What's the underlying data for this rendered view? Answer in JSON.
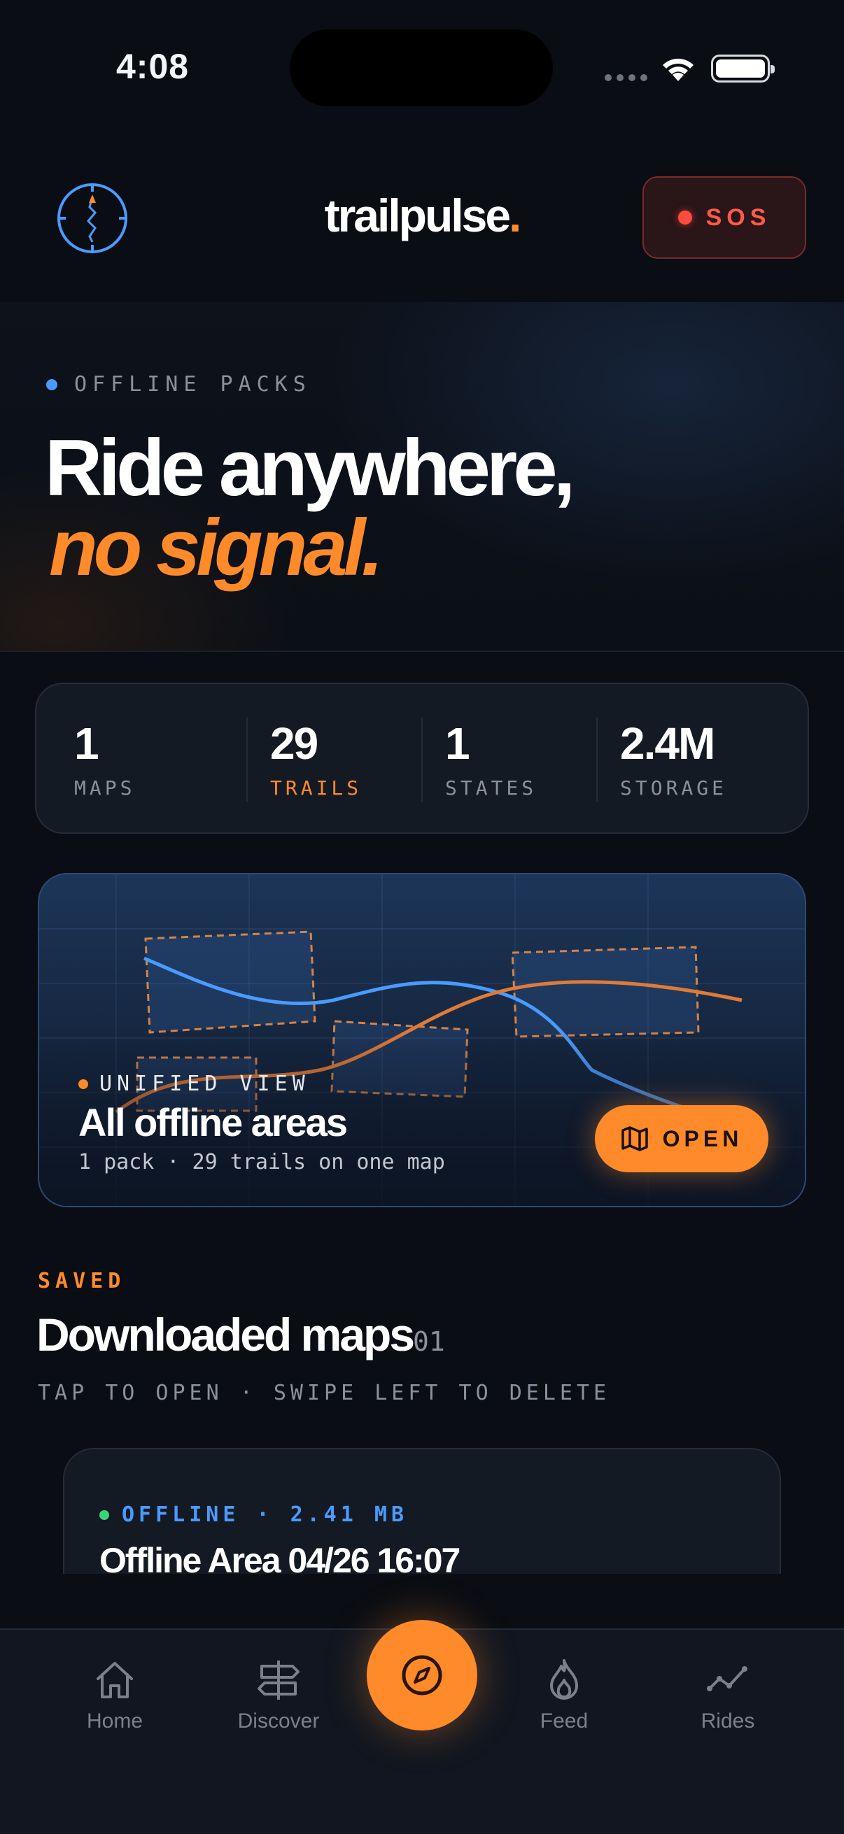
{
  "status_bar": {
    "time": "4:08"
  },
  "header": {
    "brand": "trailpulse",
    "brand_dot": ".",
    "sos_label": "SOS"
  },
  "hero": {
    "eyebrow": "OFFLINE PACKS",
    "headline_line1": "Ride anywhere,",
    "headline_line2": "no signal."
  },
  "stats": [
    {
      "value": "1",
      "label": "MAPS"
    },
    {
      "value": "29",
      "label": "TRAILS"
    },
    {
      "value": "1",
      "label": "STATES"
    },
    {
      "value": "2.4M",
      "label": "STORAGE"
    }
  ],
  "unified_view": {
    "eyebrow": "UNIFIED VIEW",
    "title": "All offline areas",
    "subtitle": "1 pack · 29 trails on one map",
    "open_label": "OPEN"
  },
  "saved": {
    "eyebrow": "SAVED",
    "title": "Downloaded maps",
    "count": "01",
    "hint": "TAP TO OPEN · SWIPE LEFT TO DELETE",
    "items": [
      {
        "meta": "OFFLINE · 2.41 MB",
        "title": "Offline Area 04/26 16:07"
      }
    ]
  },
  "tabbar": {
    "tabs": [
      {
        "label": "Home",
        "icon": "home-icon"
      },
      {
        "label": "Discover",
        "icon": "signpost-icon"
      },
      {
        "label": "",
        "icon": "compass-icon"
      },
      {
        "label": "Feed",
        "icon": "flame-icon"
      },
      {
        "label": "Rides",
        "icon": "activity-chart-icon"
      }
    ]
  },
  "colors": {
    "accent": "#ff8a2a",
    "blue": "#4a9bff",
    "sos": "#ff4a3d",
    "background": "#0a0d13"
  }
}
